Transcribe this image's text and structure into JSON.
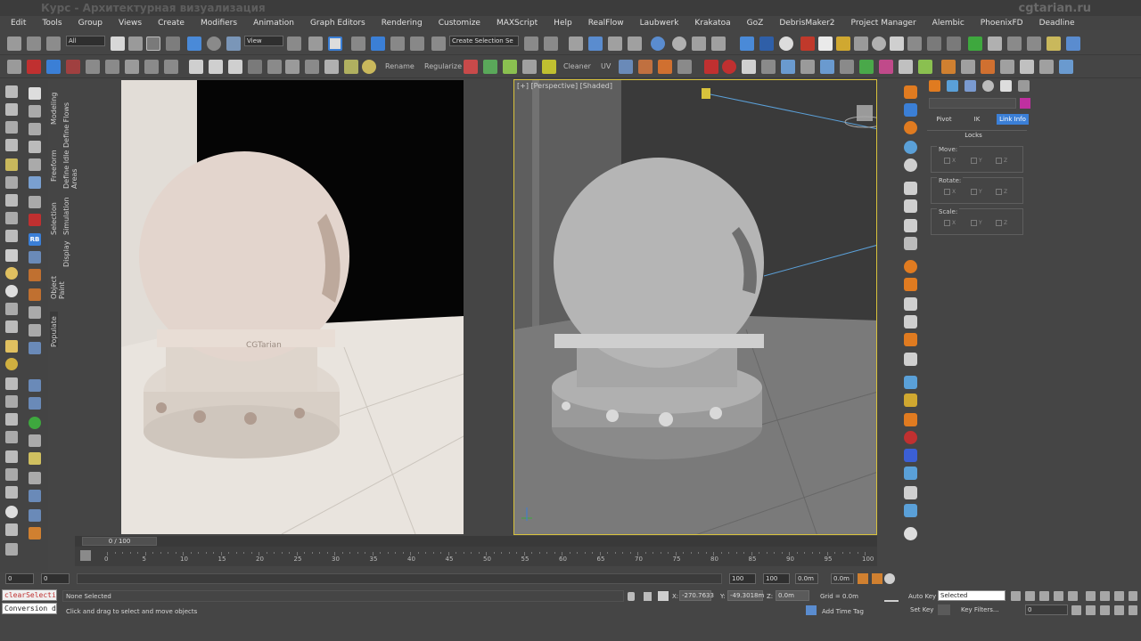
{
  "window": {
    "title": "Курс - Архитектурная визуализация",
    "brand": "cgtarian.ru"
  },
  "menu": [
    "Edit",
    "Tools",
    "Group",
    "Views",
    "Create",
    "Modifiers",
    "Animation",
    "Graph Editors",
    "Rendering",
    "Customize",
    "MAXScript",
    "Help",
    "RealFlow",
    "Laubwerk",
    "Krakatoa",
    "GoZ",
    "DebrisMaker2",
    "Project Manager",
    "Alembic",
    "PhoenixFD",
    "Deadline"
  ],
  "toolbar1": {
    "selection_filter": "All",
    "coord_system": "View",
    "named_selection": "Create Selection Se"
  },
  "toolbar2": {
    "rename_label": "Rename",
    "regularize_label": "Regularize",
    "cleaner_label": "Cleaner",
    "uv_label": "UV"
  },
  "side_tabs": [
    "Define Flows",
    "Define Idle Areas",
    "Simulation",
    "Display",
    "Modeling",
    "Freeform",
    "Selection",
    "Object Paint",
    "Populate"
  ],
  "viewport": {
    "persp_label": "[+] [Perspective] [Shaded]",
    "render_logo": "CGTarian"
  },
  "command_panel": {
    "tabs": [
      "Pivot",
      "IK",
      "Link Info"
    ],
    "active_tab": "Link Info",
    "locks_title": "Locks",
    "groups": [
      {
        "label": "Move:",
        "axes": [
          "X",
          "Y",
          "Z"
        ]
      },
      {
        "label": "Rotate:",
        "axes": [
          "X",
          "Y",
          "Z"
        ]
      },
      {
        "label": "Scale:",
        "axes": [
          "X",
          "Y",
          "Z"
        ]
      }
    ],
    "object_color": "#c02fa0"
  },
  "timeline": {
    "slider_text": "0 / 100",
    "ticks": [
      "0",
      "5",
      "10",
      "15",
      "20",
      "25",
      "30",
      "35",
      "40",
      "45",
      "50",
      "55",
      "60",
      "65",
      "70",
      "75",
      "80",
      "85",
      "90",
      "95",
      "100"
    ]
  },
  "frame_row": {
    "start": "0",
    "end": "0",
    "end_frame": "100",
    "end_frame2": "100",
    "zoom1": "0.0m",
    "zoom2": "0.0m"
  },
  "status": {
    "script_line1": "clearSelecti",
    "script_line2": "Conversion d",
    "selection_status": "None Selected",
    "prompt": "Click and drag to select and move objects",
    "x_label": "X:",
    "x_value": "-270.7633",
    "y_label": "Y:",
    "y_value": "-49.3018m",
    "z_label": "Z:",
    "z_value": "0.0m",
    "grid": "Grid = 0.0m",
    "add_time_tag": "Add Time Tag",
    "auto_key": "Auto Key",
    "set_key": "Set Key",
    "selected_option": "Selected",
    "key_filters": "Key Filters...",
    "current_frame": "0"
  }
}
